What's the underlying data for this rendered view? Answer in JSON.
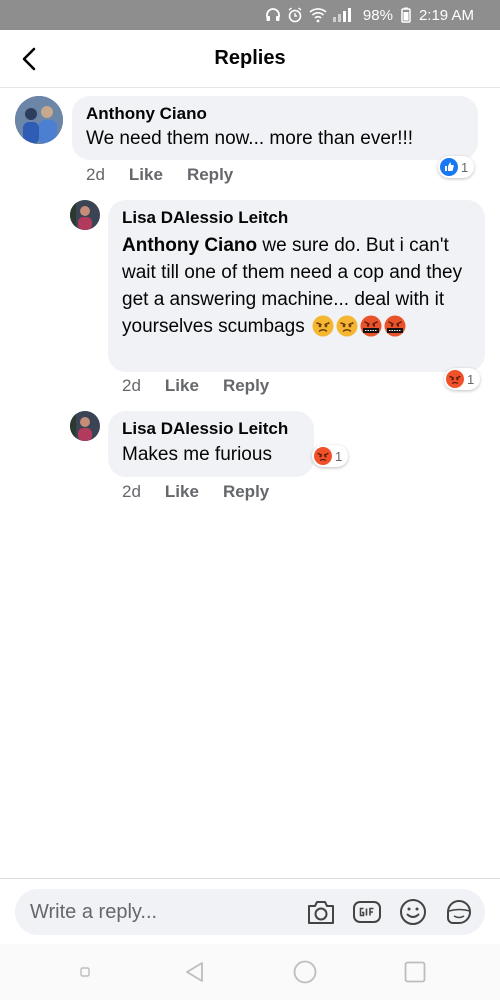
{
  "status_bar": {
    "battery": "98%",
    "time": "2:19 AM"
  },
  "header": {
    "title": "Replies"
  },
  "comments": [
    {
      "author": "Anthony Ciano",
      "text": "We need them now... more than ever!!!",
      "time": "2d",
      "like_label": "Like",
      "reply_label": "Reply",
      "reaction": "like-icon",
      "reaction_count": "1"
    },
    {
      "author": "Lisa DAlessio Leitch",
      "mention": "Anthony Ciano",
      "text": " we sure do. But i can't wait till one of them need a cop and they get a answering machine... deal with it yourselves scumbags",
      "time": "2d",
      "like_label": "Like",
      "reply_label": "Reply",
      "reaction": "angry-icon",
      "reaction_count": "1"
    },
    {
      "author": "Lisa DAlessio Leitch",
      "text": "Makes me furious",
      "time": "2d",
      "like_label": "Like",
      "reply_label": "Reply",
      "reaction": "angry-icon",
      "reaction_count": "1"
    }
  ],
  "composer": {
    "placeholder": "Write a reply..."
  },
  "colors": {
    "bubble": "#f0f2f5",
    "like_blue": "#1877f2",
    "angry_orange": "#f0512a"
  }
}
